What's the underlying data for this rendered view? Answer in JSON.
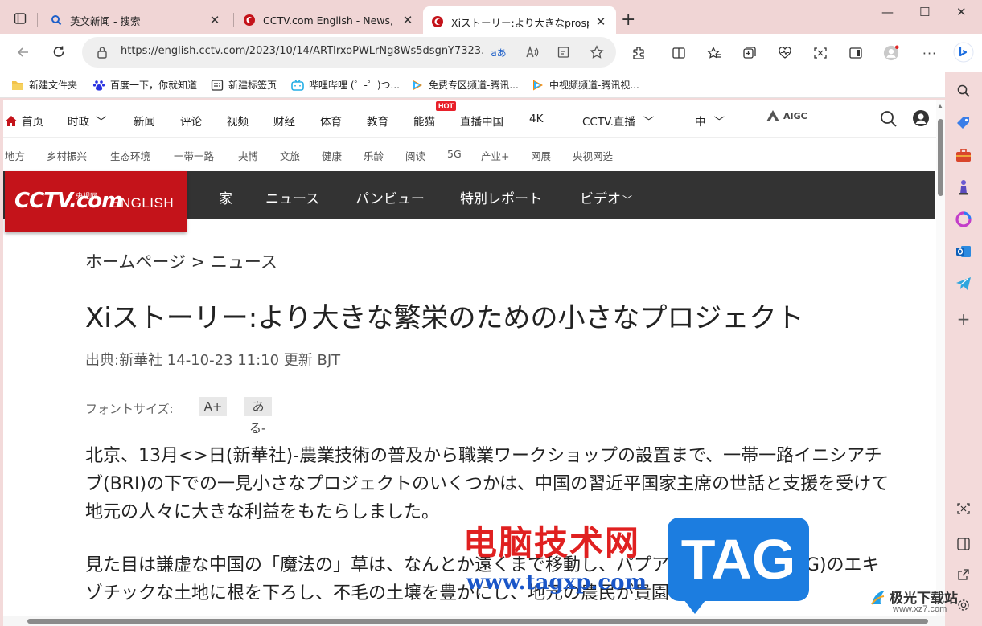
{
  "tabs": [
    {
      "title": "英文新闻 - 搜索",
      "close": "✕"
    },
    {
      "title": "CCTV.com English - News, Video",
      "close": "✕"
    },
    {
      "title": "Xiストーリー:より大きなprosper",
      "close": "✕"
    }
  ],
  "window": {
    "new_tab": "+",
    "minimize": "—",
    "maximize": "☐",
    "close": "✕"
  },
  "address": {
    "url": "https://english.cctv.com/2023/10/14/ARTIrxoPWLrNg8Ws5dsgnY7323...",
    "translate": "aあ"
  },
  "favorites": [
    {
      "label": "新建文件夹",
      "icon": "folder-icon"
    },
    {
      "label": "百度一下，你就知道",
      "icon": "baidu-icon"
    },
    {
      "label": "新建标签页",
      "icon": "newtab-icon"
    },
    {
      "label": "哔哩哔哩 (゜-゜)つ...",
      "icon": "bilibili-icon"
    },
    {
      "label": "免费专区频道-腾讯...",
      "icon": "tencent-video-icon"
    },
    {
      "label": "中视频频道-腾讯视...",
      "icon": "tencent-video-icon"
    }
  ],
  "cctv_nav": {
    "home": "首页",
    "items": [
      "时政",
      "新闻",
      "评论",
      "视频",
      "财经",
      "体育",
      "教育",
      "能猫",
      "直播中国",
      "4K",
      "CCTV.直播",
      "中"
    ],
    "hot": "HOT",
    "aigc": "AIGC"
  },
  "cctv_subnav": [
    "地方",
    "乡村振兴",
    "生态环境",
    "一带一路",
    "央博",
    "文旅",
    "健康",
    "乐龄",
    "阅读",
    "5G",
    "产业+",
    "网展",
    "央视网选"
  ],
  "english_bar": {
    "logo_cctv": "CCTV.com",
    "logo_cn": "央视网",
    "logo_english": "ENGLISH",
    "items": [
      "家",
      "ニュース",
      "パンビュー",
      "特別レポート",
      "ビデオ"
    ]
  },
  "article": {
    "breadcrumb": "ホームページ > ニュース",
    "title": "Xiストーリー:より大きな繁栄のための小さなプロジェクト",
    "source": "出典:新華社 14-10-23 11:10 更新 BJT",
    "font_size_label": "フォントサイズ:",
    "font_plus": "A+",
    "font_minus": "あ",
    "font_minus_suffix": "る-",
    "paragraphs": [
      "北京、13月<>日(新華社)-農業技術の普及から職業ワークショップの設置まで、一帯一路イニシアチブ(BRI)の下での一見小さなプロジェクトのいくつかは、中国の習近平国家主席の世話と支援を受けて地元の人々に大きな利益をもたらしました。",
      "見た目は謙虚な中国の「魔法の」草は、なんとか遠くまで移動し、パプアニューギニア(PNG)のエキゾチックな土地に根を下ろし、不毛の土壌を豊かにし、地元の農民が貴園を克"
    ]
  },
  "watermark": {
    "site": "电脑技术网",
    "url": "www.tagxp.com",
    "tag": "TAG",
    "brand": "极光下载站",
    "brand_url": "www.xz7.com"
  },
  "colors": {
    "tab_bar": "#f0d5d5",
    "cctv_red": "#c4131a",
    "english_bar": "#333333",
    "hot": "#e8202a"
  }
}
